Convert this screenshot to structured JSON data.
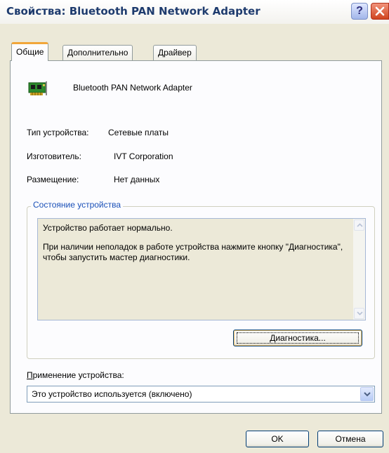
{
  "window": {
    "title": "Свойства: Bluetooth PAN Network Adapter",
    "help_label": "?"
  },
  "tabs": [
    {
      "label": "Общие",
      "active": true
    },
    {
      "label": "Дополнительно",
      "active": false
    },
    {
      "label": "Драйвер",
      "active": false
    }
  ],
  "device": {
    "name": "Bluetooth PAN Network Adapter",
    "icon": "network-card-icon"
  },
  "properties": {
    "type_label": "Тип устройства:",
    "type_value": "Сетевые платы",
    "manufacturer_label": "Изготовитель:",
    "manufacturer_value": "IVT Corporation",
    "location_label": "Размещение:",
    "location_value": "Нет данных"
  },
  "status_group": {
    "title": "Состояние устройства",
    "line1": "Устройство работает нормально.",
    "line2": "При наличии неполадок в работе устройства нажмите кнопку \"Диагностика\", чтобы запустить мастер диагностики.",
    "diagnostics_button": {
      "prefix": "",
      "mnemonic": "Д",
      "rest": "иагностика..."
    }
  },
  "usage": {
    "label_mnemonic": "П",
    "label_rest": "рименение устройства:",
    "selected": "Это устройство используется (включено)"
  },
  "buttons": {
    "ok": "OK",
    "cancel": "Отмена"
  },
  "colors": {
    "title_text": "#1e3b6e",
    "group_title": "#1a50b8",
    "close_button": "#d0441f",
    "active_tab_accent": "#f1a63a"
  }
}
